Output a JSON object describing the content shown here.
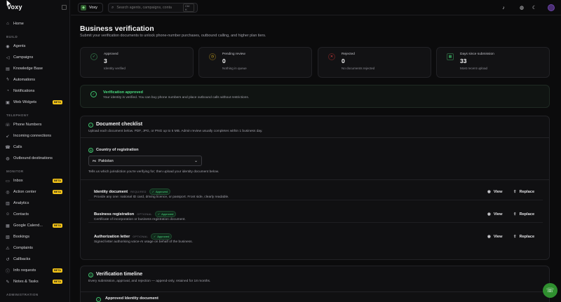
{
  "app": {
    "brand": "Voxy"
  },
  "sidebar": {
    "top_item": "Home",
    "sections": [
      {
        "title": "BUILD",
        "items": [
          {
            "label": "Agents",
            "icon": "bot-icon"
          },
          {
            "label": "Campaigns",
            "icon": "megaphone-icon"
          },
          {
            "label": "Knowledge Base",
            "icon": "book-icon"
          },
          {
            "label": "Automations",
            "icon": "bolt-icon"
          },
          {
            "label": "Notifications",
            "icon": "bell-icon"
          },
          {
            "label": "Web Widgets",
            "icon": "widget-icon",
            "beta": "BETA"
          }
        ]
      },
      {
        "title": "TELEPHONY",
        "items": [
          {
            "label": "Phone Numbers",
            "icon": "phone-icon"
          },
          {
            "label": "Incoming connections",
            "icon": "incoming-icon"
          },
          {
            "label": "Calls",
            "icon": "call-icon"
          },
          {
            "label": "Outbound destinations",
            "icon": "globe-icon"
          }
        ]
      },
      {
        "title": "MONITOR",
        "items": [
          {
            "label": "Inbox",
            "icon": "inbox-icon",
            "beta": "BETA"
          },
          {
            "label": "Action center",
            "icon": "target-icon",
            "beta": "BETA"
          },
          {
            "label": "Analytics",
            "icon": "chart-icon"
          },
          {
            "label": "Contacts",
            "icon": "contacts-icon"
          },
          {
            "label": "Google Calend...",
            "icon": "calendar-icon",
            "beta": "BETA"
          },
          {
            "label": "Bookings",
            "icon": "booking-icon"
          },
          {
            "label": "Complaints",
            "icon": "alert-icon"
          },
          {
            "label": "Callbacks",
            "icon": "callback-icon"
          },
          {
            "label": "Info requests",
            "icon": "info-icon",
            "beta": "BETA"
          },
          {
            "label": "Notes & Tasks",
            "icon": "notes-icon",
            "beta": "BETA"
          }
        ]
      },
      {
        "title": "ADMINISTRATION",
        "items": []
      }
    ]
  },
  "topbar": {
    "workspace": "Voxy",
    "search_placeholder": "Search agents, campaigns, conta",
    "shortcut": "Ctrl K"
  },
  "page": {
    "title": "Business verification",
    "subtitle": "Submit your verification documents to unlock phone-number purchases, outbound calling, and higher plan tiers."
  },
  "stats": [
    {
      "label": "Approved",
      "value": "3",
      "note": "Identity verified",
      "icon": "check-circle-icon",
      "color": "#3ec46d"
    },
    {
      "label": "Pending review",
      "value": "0",
      "note": "Nothing in queue",
      "icon": "clock-icon",
      "color": "#f5c518"
    },
    {
      "label": "Rejected",
      "value": "0",
      "note": "No documents rejected",
      "icon": "x-circle-icon",
      "color": "#ef4444"
    },
    {
      "label": "Days since submission",
      "value": "33",
      "note": "Most recent upload",
      "icon": "calendar-icon",
      "color": "#3ec46d"
    }
  ],
  "banner": {
    "title": "Verification approved",
    "text": "Your identity is verified. You can buy phone numbers and place outbound calls without restrictions."
  },
  "checklist": {
    "title": "Document checklist",
    "subtitle": "Upload each document below. PDF, JPG, or PNG up to 5 MB. Admin review usually completes within 1 business day.",
    "country_label": "Country of registration",
    "country_code": "PK",
    "country_value": "Pakistan",
    "country_help": "Tells us which jurisdiction you're verifying for; then upload your identity document below.",
    "view_label": "View",
    "replace_label": "Replace",
    "documents": [
      {
        "name": "Identity document",
        "tag": "REQUIRED",
        "status": "Approved",
        "desc": "Provide any one: national ID card, driving licence, or passport. Front side, clearly readable."
      },
      {
        "name": "Business registration",
        "tag": "OPTIONAL",
        "status": "Approved",
        "desc": "Certificate of incorporation or business registration document."
      },
      {
        "name": "Authorization letter",
        "tag": "OPTIONAL",
        "status": "Approved",
        "desc": "Signed letter authorising voice-AI usage on behalf of the business."
      }
    ]
  },
  "timeline": {
    "title": "Verification timeline",
    "subtitle": "Every submission, approval, and rejection — append-only, retained for 18 months.",
    "first_entry": "Approved Identity document"
  }
}
